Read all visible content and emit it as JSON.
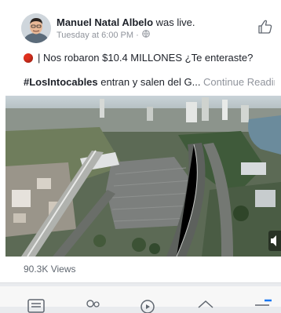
{
  "post": {
    "author_name": "Manuel Natal Albelo",
    "author_action": " was live.",
    "timestamp": "Tuesday at 6:00 PM · ",
    "text": "| Nos robaron $10.4 MILLONES ¿Te enteraste?",
    "hashtag": "#LosIntocables",
    "hashtag_rest": " entran y salen del G... ",
    "continue_label": "Continue Reading",
    "views": "90.3K Views"
  },
  "icons": {
    "avatar": "avatar",
    "privacy": "globe-icon",
    "like": "thumbs-up-icon",
    "live": "red-circle-icon",
    "sound": "speaker-icon"
  },
  "colors": {
    "text": "#1d2129",
    "meta": "#90949c",
    "accent": "#1877f2",
    "live_red": "#e0301e"
  },
  "tabbar": {
    "items": [
      "news-feed-icon",
      "friends-icon",
      "watch-icon",
      "home-icon",
      "menu-icon"
    ],
    "active_index": 4
  }
}
